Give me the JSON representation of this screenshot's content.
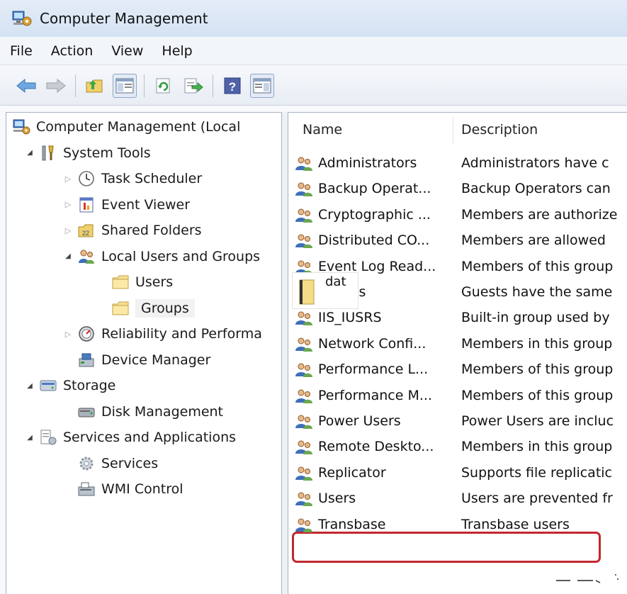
{
  "window": {
    "title": "Computer Management"
  },
  "menu": [
    "File",
    "Action",
    "View",
    "Help"
  ],
  "tree": [
    {
      "label": "Computer Management (Local",
      "icon": "computer-management-icon",
      "level": 0,
      "arrow": ""
    },
    {
      "label": "System Tools",
      "icon": "tools-icon",
      "level": 1,
      "arrow": "expanded"
    },
    {
      "label": "Task Scheduler",
      "icon": "clock-icon",
      "level": 2,
      "arrow": "collapsed"
    },
    {
      "label": "Event Viewer",
      "icon": "event-viewer-icon",
      "level": 2,
      "arrow": "collapsed"
    },
    {
      "label": "Shared Folders",
      "icon": "shared-folder-icon",
      "level": 2,
      "arrow": "collapsed"
    },
    {
      "label": "Local Users and Groups",
      "icon": "users-icon",
      "level": 2,
      "arrow": "expanded"
    },
    {
      "label": "Users",
      "icon": "folder-icon",
      "level": 3,
      "arrow": ""
    },
    {
      "label": "Groups",
      "icon": "folder-icon",
      "level": 3,
      "arrow": "",
      "selected": true
    },
    {
      "label": "Reliability and Performa",
      "icon": "performance-icon",
      "level": 2,
      "arrow": "collapsed"
    },
    {
      "label": "Device Manager",
      "icon": "device-manager-icon",
      "level": 2,
      "arrow": ""
    },
    {
      "label": "Storage",
      "icon": "storage-icon",
      "level": 1,
      "arrow": "expanded"
    },
    {
      "label": "Disk Management",
      "icon": "disk-icon",
      "level": 2,
      "arrow": ""
    },
    {
      "label": "Services and Applications",
      "icon": "services-apps-icon",
      "level": 1,
      "arrow": "expanded"
    },
    {
      "label": "Services",
      "icon": "gear-icon",
      "level": 2,
      "arrow": ""
    },
    {
      "label": "WMI Control",
      "icon": "wmi-icon",
      "level": 2,
      "arrow": ""
    }
  ],
  "list": {
    "columns": [
      "Name",
      "Description"
    ],
    "rows": [
      {
        "name": "Administrators",
        "description": "Administrators have c"
      },
      {
        "name": "Backup Operat...",
        "description": "Backup Operators can"
      },
      {
        "name": "Cryptographic ...",
        "description": "Members are authorize"
      },
      {
        "name": "Distributed CO...",
        "description": "Members are allowed"
      },
      {
        "name": "Event Log Read...",
        "description": "Members of this group"
      },
      {
        "name": "ts",
        "description": "Guests have the same"
      },
      {
        "name": "IIS_IUSRS",
        "description": "Built-in group used by"
      },
      {
        "name": "Network Confi...",
        "description": "Members in this group"
      },
      {
        "name": "Performance L...",
        "description": "Members of this group"
      },
      {
        "name": "Performance M...",
        "description": "Members of this group"
      },
      {
        "name": "Power Users",
        "description": "Power Users are incluc"
      },
      {
        "name": "Remote Deskto...",
        "description": "Members in this group"
      },
      {
        "name": "Replicator",
        "description": "Supports file replicatic"
      },
      {
        "name": "Users",
        "description": "Users are prevented fr"
      },
      {
        "name": "Transbase",
        "description": "Transbase users",
        "highlighted": true
      }
    ]
  },
  "tooltip": {
    "text": "dat"
  },
  "colors": {
    "highlight_border": "#c1272d",
    "pane_border": "#a9b3c0",
    "titlebar": "#d9e5f4"
  }
}
